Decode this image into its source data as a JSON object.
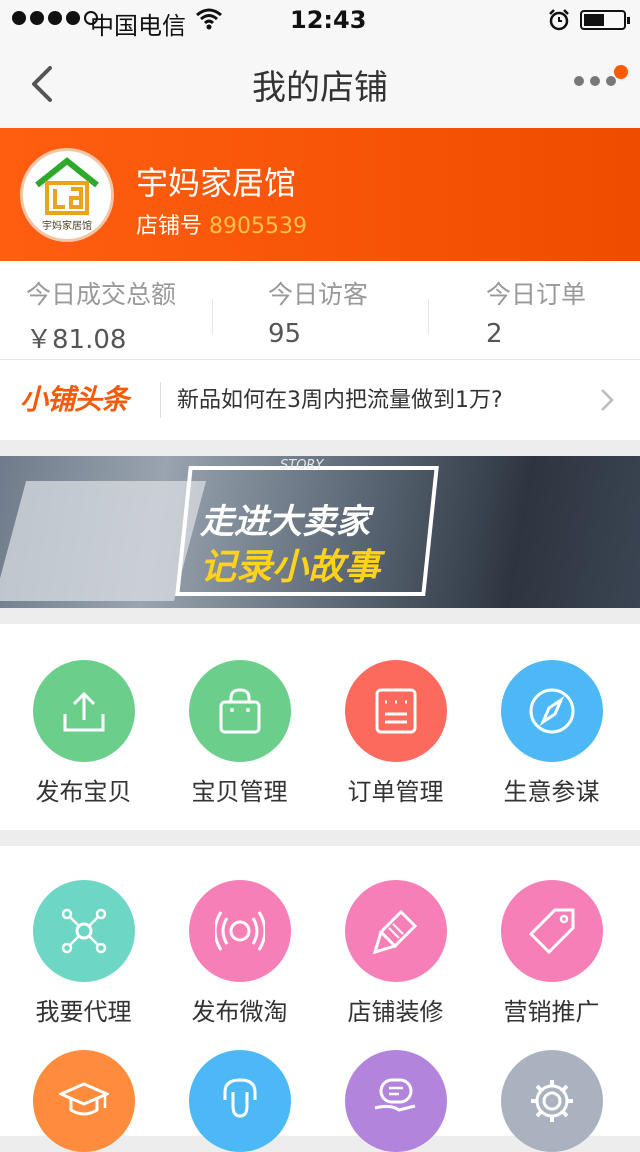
{
  "status_bar": {
    "carrier": "中国电信",
    "time": "12:43"
  },
  "nav": {
    "title": "我的店铺"
  },
  "shop": {
    "logo_text": "宇妈家居馆",
    "name": "宇妈家居馆",
    "id_label": "店铺号",
    "id_value": "8905539"
  },
  "stats": [
    {
      "label": "今日成交总额",
      "value": "￥81.08"
    },
    {
      "label": "今日访客",
      "value": "95"
    },
    {
      "label": "今日订单",
      "value": "2"
    }
  ],
  "headline": {
    "brand": "小铺头条",
    "text": "新品如何在3周内把流量做到1万?"
  },
  "banner": {
    "tag": "STORY",
    "line1": "走进大卖家",
    "line2": "记录小故事"
  },
  "tools_row1": [
    {
      "label": "发布宝贝",
      "icon": "upload-icon",
      "color": "#6cce8b"
    },
    {
      "label": "宝贝管理",
      "icon": "shopping-bag-icon",
      "color": "#6cce8b"
    },
    {
      "label": "订单管理",
      "icon": "order-list-icon",
      "color": "#fb6a5c"
    },
    {
      "label": "生意参谋",
      "icon": "compass-icon",
      "color": "#4cb9f6"
    }
  ],
  "tools_row2": [
    {
      "label": "我要代理",
      "icon": "network-icon",
      "color": "#6dd6c4"
    },
    {
      "label": "发布微淘",
      "icon": "broadcast-icon",
      "color": "#f77fb8"
    },
    {
      "label": "店铺装修",
      "icon": "brush-icon",
      "color": "#f77fb8"
    },
    {
      "label": "营销推广",
      "icon": "tag-icon",
      "color": "#f77fb8"
    }
  ],
  "tools_row3": [
    {
      "label": "",
      "icon": "graduation-cap-icon",
      "color": "#ff8b3d"
    },
    {
      "label": "",
      "icon": "headset-icon",
      "color": "#4cb9f6"
    },
    {
      "label": "",
      "icon": "handshake-icon",
      "color": "#b284dc"
    },
    {
      "label": "",
      "icon": "gear-icon",
      "color": "#a9b2be"
    }
  ]
}
